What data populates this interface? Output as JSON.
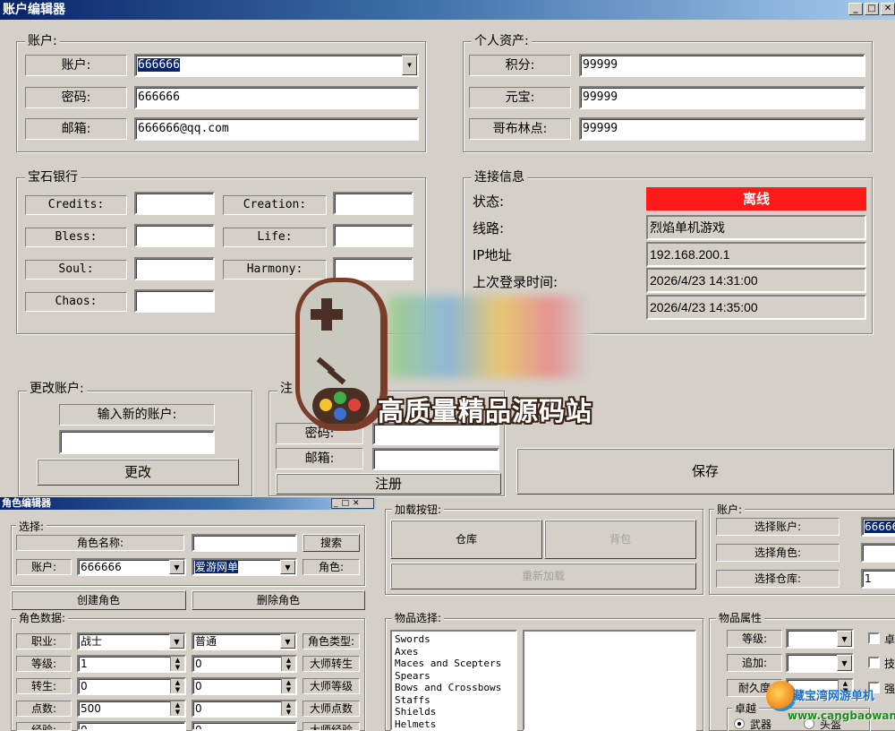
{
  "window": {
    "title": "账户编辑器",
    "btn_min": "_",
    "btn_max": "□",
    "btn_close": "✕"
  },
  "account": {
    "group": "账户:",
    "account_label": "账户:",
    "account_value": "666666",
    "password_label": "密码:",
    "password_value": "666666",
    "email_label": "邮箱:",
    "email_value": "666666@qq.com"
  },
  "assets": {
    "group": "个人资产:",
    "points_label": "积分:",
    "points_value": "99999",
    "yuanbao_label": "元宝:",
    "yuanbao_value": "99999",
    "goblin_label": "哥布林点:",
    "goblin_value": "99999"
  },
  "gem_bank": {
    "group": "宝石银行",
    "credits_label": "Credits:",
    "creation_label": "Creation:",
    "bless_label": "Bless:",
    "life_label": "Life:",
    "soul_label": "Soul:",
    "harmony_label": "Harmony:",
    "chaos_label": "Chaos:"
  },
  "connection": {
    "group": "连接信息",
    "status_label": "状态:",
    "status_value": "离线",
    "status_color": "#ff1a1a",
    "line_label": "线路:",
    "line_value": "烈焰单机游戏",
    "ip_label": "IP地址",
    "ip_value": "192.168.200.1",
    "last_login_label": "上次登录时间:",
    "last_login_value": "2026/4/23 14:31:00",
    "time2_value": "2026/4/23 14:35:00"
  },
  "change_account": {
    "group": "更改账户:",
    "new_label": "输入新的账户:",
    "change_button": "更改"
  },
  "register": {
    "group": "注",
    "password_label": "密码:",
    "email_label": "邮箱:",
    "register_button": "注册"
  },
  "save_button": "保存",
  "watermark": {
    "text": "高质量精品源码站"
  },
  "char_editor": {
    "title": "角色编辑器",
    "select_group": "选择:",
    "char_name_label": "角色名称:",
    "search_button": "搜索",
    "account_label": "账户:",
    "account_value": "666666",
    "server_value": "爱游网单",
    "role_label": "角色:",
    "create_button": "创建角色",
    "delete_button": "删除角色",
    "data_group": "角色数据:",
    "job_label": "职业:",
    "job_value": "战士",
    "job_value2": "普通",
    "char_type_label": "角色类型:",
    "level_label": "等级:",
    "level_value": "1",
    "level_value2": "0",
    "master_reset_label": "大师转生",
    "reset_label": "转生:",
    "reset_value": "0",
    "reset_value2": "0",
    "master_level_label": "大师等级",
    "points_label": "点数:",
    "points_value": "500",
    "points_value2": "0",
    "master_points_label": "大师点数",
    "exp_label": "经验:",
    "exp_value": "0",
    "exp_value2": "0",
    "master_exp_label": "大师经验"
  },
  "load_buttons": {
    "group": "加载按钮:",
    "warehouse": "仓库",
    "bag": "背包",
    "reload": "重新加载"
  },
  "right_account": {
    "group": "账户:",
    "select_account_label": "选择账户:",
    "select_account_value": "66666",
    "select_role_label": "选择角色:",
    "select_warehouse_label": "选择仓库:",
    "warehouse_value": "1"
  },
  "item_select": {
    "group": "物品选择:",
    "items": [
      "Swords",
      "Axes",
      "Maces and Scepters",
      "Spears",
      "Bows and Crossbows",
      "Staffs",
      "Shields",
      "Helmets"
    ]
  },
  "item_props": {
    "group": "物品属性",
    "level_label": "等级:",
    "add_label": "追加:",
    "durability_label": "耐久度",
    "chk1": "卓",
    "chk2": "技",
    "chk3": "强",
    "ex_group": "卓越",
    "radio1": "武器",
    "radio2": "头盔"
  },
  "site_logo": {
    "name": "藏宝湾网游单机",
    "url": "www.cangbaowan.net"
  }
}
